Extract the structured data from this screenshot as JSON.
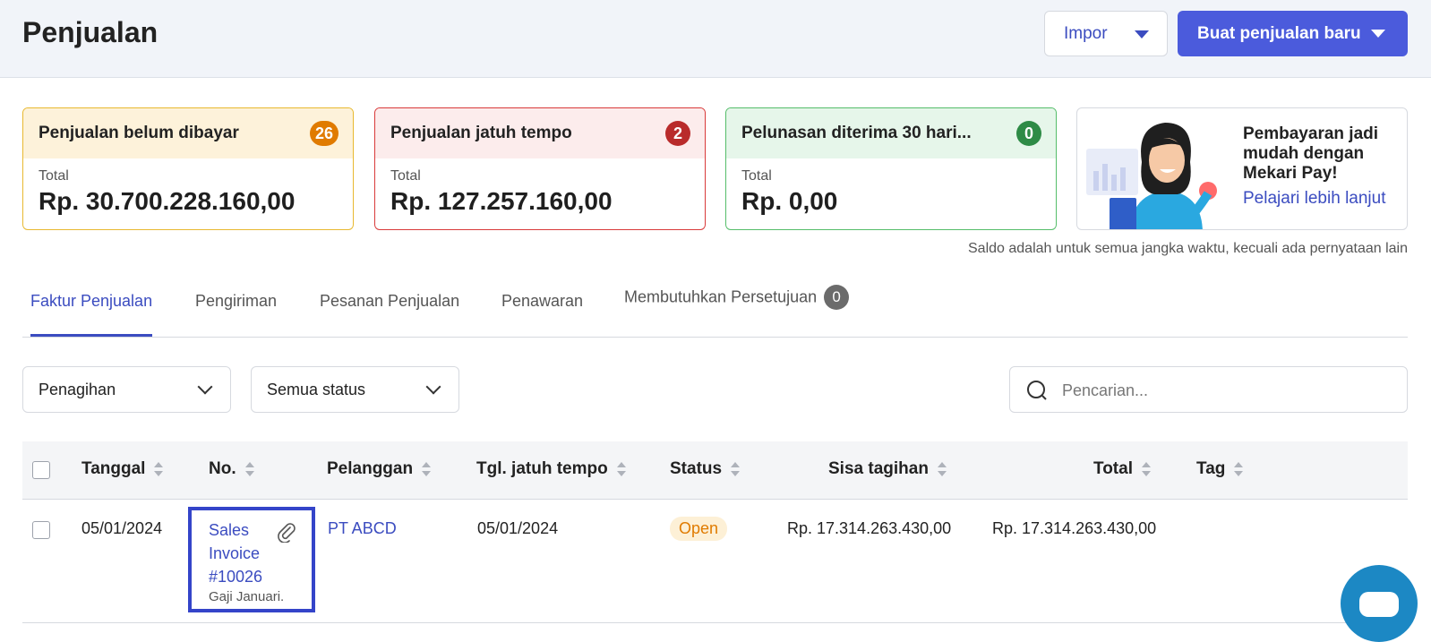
{
  "header": {
    "title": "Penjualan",
    "import_label": "Impor",
    "new_sale_label": "Buat penjualan baru"
  },
  "cards": [
    {
      "title": "Penjualan belum dibayar",
      "count": "26",
      "label": "Total",
      "value": "Rp. 30.700.228.160,00"
    },
    {
      "title": "Penjualan jatuh tempo",
      "count": "2",
      "label": "Total",
      "value": "Rp. 127.257.160,00"
    },
    {
      "title": "Pelunasan diterima 30 hari...",
      "count": "0",
      "label": "Total",
      "value": "Rp. 0,00"
    }
  ],
  "promo": {
    "text": "Pembayaran jadi mudah dengan Mekari Pay!",
    "link": "Pelajari lebih lanjut"
  },
  "balance_note": "Saldo adalah untuk semua jangka waktu, kecuali ada pernyataan lain",
  "tabs": [
    {
      "label": "Faktur Penjualan"
    },
    {
      "label": "Pengiriman"
    },
    {
      "label": "Pesanan Penjualan"
    },
    {
      "label": "Penawaran"
    },
    {
      "label": "Membutuhkan Persetujuan",
      "count": "0"
    }
  ],
  "filters": {
    "type": "Penagihan",
    "status": "Semua status",
    "search_placeholder": "Pencarian..."
  },
  "table": {
    "columns": [
      "Tanggal",
      "No.",
      "Pelanggan",
      "Tgl. jatuh tempo",
      "Status",
      "Sisa tagihan",
      "Total",
      "Tag"
    ],
    "rows": [
      {
        "date": "05/01/2024",
        "number": "Sales Invoice #10026",
        "description": "Gaji Januari.",
        "customer": "PT ABCD",
        "due_date": "05/01/2024",
        "status": "Open",
        "balance": "Rp. 17.314.263.430,00",
        "total": "Rp. 17.314.263.430,00",
        "tag": ""
      }
    ]
  },
  "colors": {
    "primary": "#4b5bdc",
    "link": "#3b4cc0",
    "status_open_bg": "#fdf0d6",
    "status_open_text": "#e07b00"
  }
}
